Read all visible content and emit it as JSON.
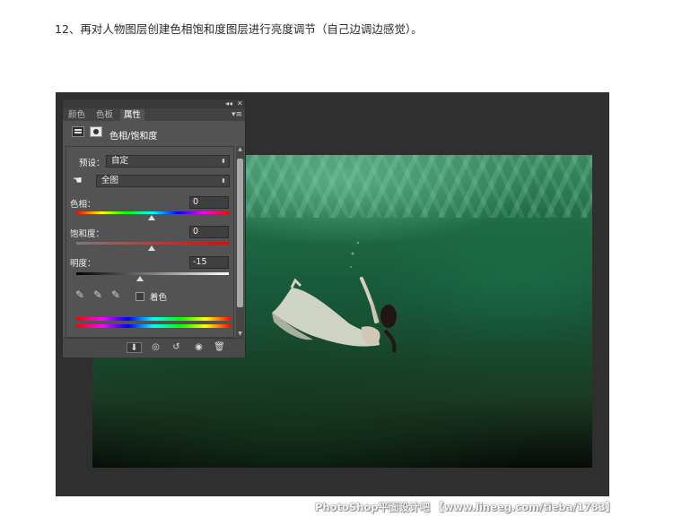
{
  "instruction": "12、再对人物图层创建色相饱和度图层进行亮度调节（自己边调边感觉）。",
  "panel": {
    "tabs": [
      "颜色",
      "色板",
      "属性"
    ],
    "active_tab": "属性",
    "title": "色相/饱和度",
    "preset_label": "预设：",
    "preset_value": "自定",
    "channel_value": "全图",
    "hue_label": "色相：",
    "hue_value": "0",
    "saturation_label": "饱和度：",
    "saturation_value": "0",
    "lightness_label": "明度：",
    "lightness_value": "-15",
    "colorize_label": "着色",
    "colorize_checked": false,
    "slider_levels": {
      "hue": 0,
      "saturation": 0,
      "lightness": -15
    }
  },
  "icons": {
    "collapse": "double-chevron-icon",
    "close": "close-icon",
    "panel_menu": "panel-menu-icon",
    "adjustment": "hue-saturation-icon",
    "mask": "mask-icon",
    "hand": "hand-icon",
    "eyedroppers": [
      "eyedropper-icon",
      "eyedropper-plus-icon",
      "eyedropper-minus-icon"
    ],
    "bottom": [
      "clip-icon",
      "view-previous-icon",
      "reset-icon",
      "visibility-icon",
      "trash-icon"
    ]
  },
  "watermark": "PhotoShop平面设计吧 【www.lineeg.com/tieba/1783】"
}
